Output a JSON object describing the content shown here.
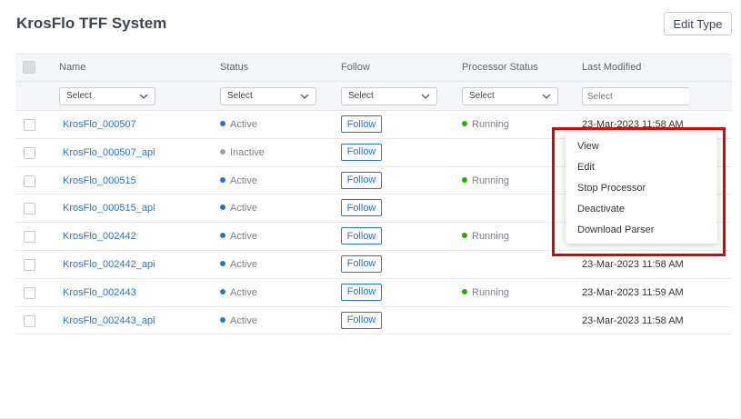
{
  "header": {
    "title": "KrosFlo TFF System",
    "edit_type_label": "Edit Type"
  },
  "columns": [
    "Name",
    "Status",
    "Follow",
    "Processor Status",
    "Last Modified"
  ],
  "filters": {
    "name": "Select",
    "status": "Select",
    "follow": "Select",
    "processor_status": "Select",
    "last_modified_placeholder": "Select"
  },
  "colors": {
    "link": "#2c72c7",
    "active": "#2c72c7",
    "inactive": "#9aa0a6",
    "running": "#22b000",
    "highlight": "#e00000"
  },
  "rows": [
    {
      "name": "KrosFlo_000507",
      "status": "Active",
      "follow": "Follow",
      "processor": "Running",
      "modified": "23-Mar-2023 11:58 AM"
    },
    {
      "name": "KrosFlo_000507_api",
      "status": "Inactive",
      "follow": "Follow",
      "processor": "",
      "modified": ""
    },
    {
      "name": "KrosFlo_000515",
      "status": "Active",
      "follow": "Follow",
      "processor": "Running",
      "modified": ""
    },
    {
      "name": "KrosFlo_000515_api",
      "status": "Active",
      "follow": "Follow",
      "processor": "",
      "modified": ""
    },
    {
      "name": "KrosFlo_002442",
      "status": "Active",
      "follow": "Follow",
      "processor": "Running",
      "modified": ""
    },
    {
      "name": "KrosFlo_002442_api",
      "status": "Active",
      "follow": "Follow",
      "processor": "",
      "modified": "23-Mar-2023 11:58 AM"
    },
    {
      "name": "KrosFlo_002443",
      "status": "Active",
      "follow": "Follow",
      "processor": "Running",
      "modified": "23-Mar-2023 11:59 AM"
    },
    {
      "name": "KrosFlo_002443_api",
      "status": "Active",
      "follow": "Follow",
      "processor": "",
      "modified": "23-Mar-2023 11:58 AM"
    }
  ],
  "context_menu": {
    "items": [
      "View",
      "Edit",
      "Stop Processor",
      "Deactivate",
      "Download Parser"
    ]
  }
}
